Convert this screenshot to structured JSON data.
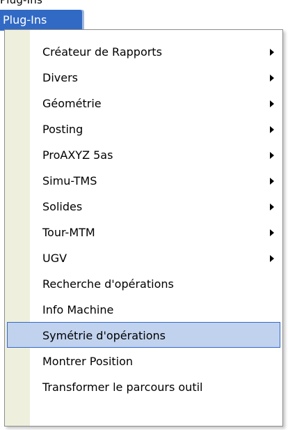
{
  "header": {
    "top_fragment": "Plug-Ins",
    "menu_title": "Plug-Ins"
  },
  "menu": {
    "items": [
      {
        "label": "Créateur de Rapports",
        "submenu": true
      },
      {
        "label": "Divers",
        "submenu": true
      },
      {
        "label": "Géométrie",
        "submenu": true
      },
      {
        "label": "Posting",
        "submenu": true
      },
      {
        "label": "ProAXYZ 5as",
        "submenu": true
      },
      {
        "label": "Simu-TMS",
        "submenu": true
      },
      {
        "label": "Solides",
        "submenu": true
      },
      {
        "label": "Tour-MTM",
        "submenu": true
      },
      {
        "label": "UGV",
        "submenu": true
      },
      {
        "label": "Recherche d'opérations",
        "submenu": false
      },
      {
        "label": "Info Machine",
        "submenu": false
      },
      {
        "label": "Symétrie d'opérations",
        "submenu": false,
        "highlighted": true
      },
      {
        "label": "Montrer Position",
        "submenu": false
      },
      {
        "label": "Transformer le parcours outil",
        "submenu": false
      }
    ]
  },
  "colors": {
    "menu_title_bg": "#316ac5",
    "highlight_bg": "#c1d2ee",
    "highlight_border": "#316ac5",
    "gutter_bg": "#efefde"
  },
  "icons": {
    "submenu": "chevron-right-icon"
  }
}
